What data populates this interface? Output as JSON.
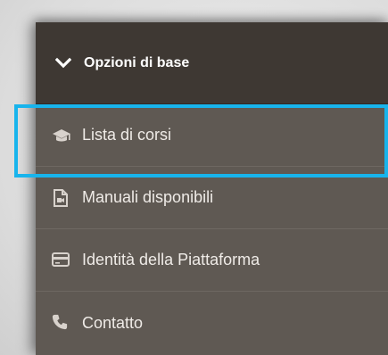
{
  "menu": {
    "header_label": "Opzioni di base",
    "items": [
      {
        "label": "Lista di corsi",
        "icon": "graduation-cap-icon"
      },
      {
        "label": "Manuali disponibili",
        "icon": "document-icon"
      },
      {
        "label": "Identità della Piattaforma",
        "icon": "credit-card-icon"
      },
      {
        "label": "Contatto",
        "icon": "phone-icon"
      }
    ]
  },
  "colors": {
    "panel": "#5f5953",
    "header": "#3e3833",
    "highlight": "#18b4ec"
  }
}
